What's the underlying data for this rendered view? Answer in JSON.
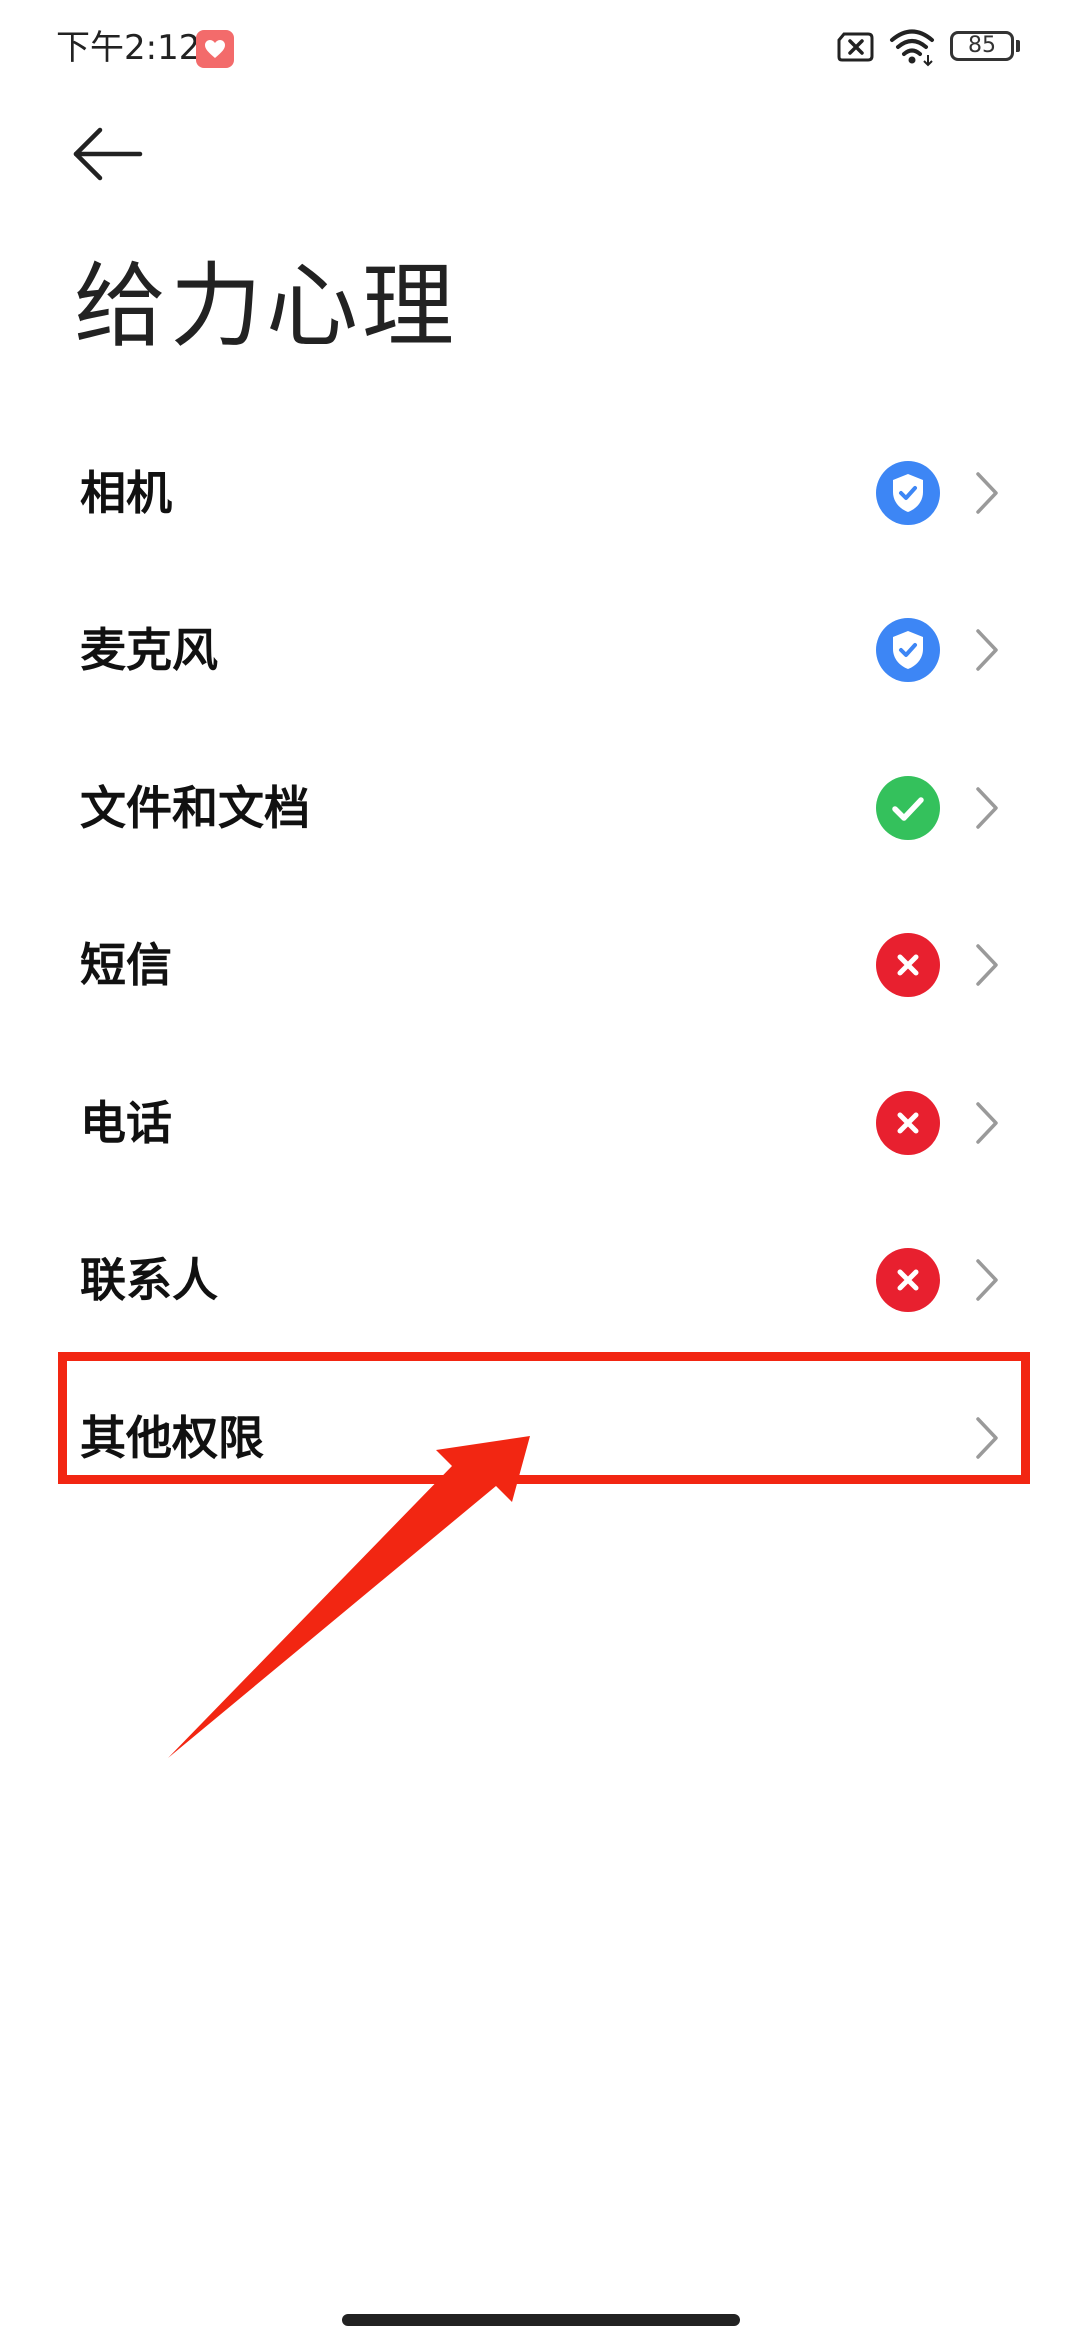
{
  "status_bar": {
    "time": "下午2:12",
    "battery_level": "85",
    "app_icon": "heart-app-icon",
    "icons": [
      "sim-x-icon",
      "wifi-icon",
      "battery-icon"
    ]
  },
  "header": {
    "back_icon": "back-arrow-icon",
    "title": "给力心理"
  },
  "permissions": [
    {
      "label": "相机",
      "status": "allowed-while-using",
      "status_icon": "shield-check-icon",
      "status_color": "#3d86f5"
    },
    {
      "label": "麦克风",
      "status": "allowed-while-using",
      "status_icon": "shield-check-icon",
      "status_color": "#3d86f5"
    },
    {
      "label": "文件和文档",
      "status": "allowed",
      "status_icon": "check-circle-icon",
      "status_color": "#34c15c"
    },
    {
      "label": "短信",
      "status": "denied",
      "status_icon": "x-circle-icon",
      "status_color": "#e8202f"
    },
    {
      "label": "电话",
      "status": "denied",
      "status_icon": "x-circle-icon",
      "status_color": "#e8202f"
    },
    {
      "label": "联系人",
      "status": "denied",
      "status_icon": "x-circle-icon",
      "status_color": "#e8202f"
    },
    {
      "label": "其他权限",
      "status": "none",
      "status_icon": "",
      "status_color": ""
    }
  ],
  "annotation": {
    "highlight_color": "#f22612",
    "arrow_color": "#f22612"
  }
}
